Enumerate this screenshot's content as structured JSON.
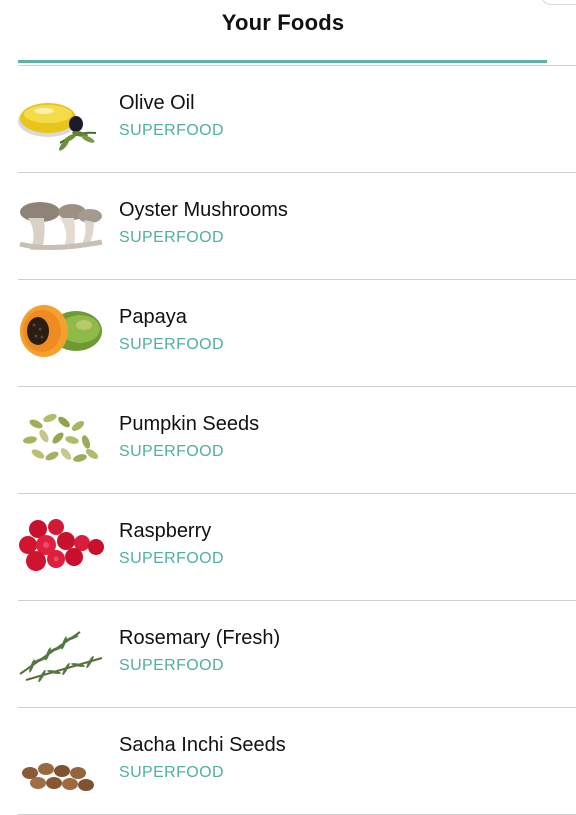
{
  "header": {
    "title": "Your Foods"
  },
  "colors": {
    "accent": "#5bb3a5",
    "tag": "#4fb0a0",
    "divider": "#cfcfcf"
  },
  "foods": [
    {
      "name": "Olive Oil",
      "tag": "SUPERFOOD",
      "icon": "olive-oil-icon"
    },
    {
      "name": "Oyster Mushrooms",
      "tag": "SUPERFOOD",
      "icon": "oyster-mushrooms-icon"
    },
    {
      "name": "Papaya",
      "tag": "SUPERFOOD",
      "icon": "papaya-icon"
    },
    {
      "name": "Pumpkin Seeds",
      "tag": "SUPERFOOD",
      "icon": "pumpkin-seeds-icon"
    },
    {
      "name": "Raspberry",
      "tag": "SUPERFOOD",
      "icon": "raspberry-icon"
    },
    {
      "name": "Rosemary (Fresh)",
      "tag": "SUPERFOOD",
      "icon": "rosemary-icon"
    },
    {
      "name": "Sacha Inchi Seeds",
      "tag": "SUPERFOOD",
      "icon": "sacha-inchi-seeds-icon"
    }
  ]
}
